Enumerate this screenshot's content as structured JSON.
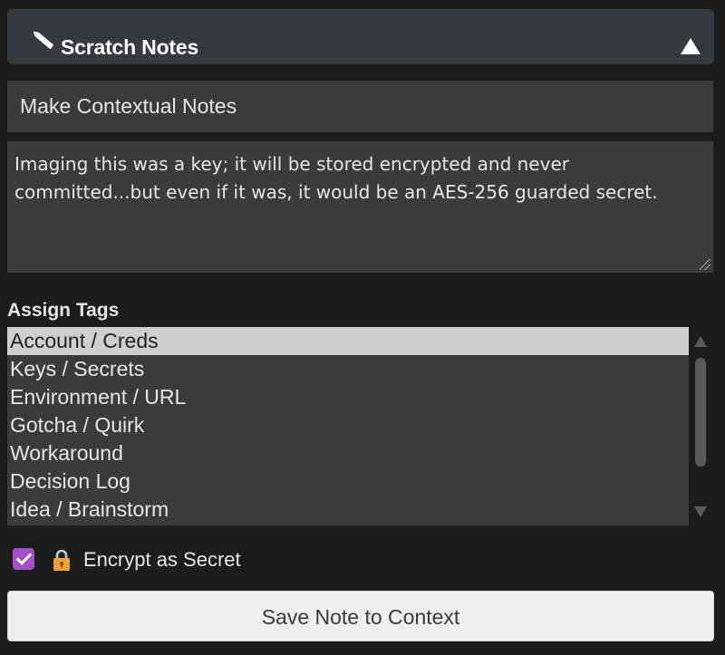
{
  "header": {
    "title": "Scratch Notes",
    "icon": "pencil-icon",
    "collapse_icon": "triangle-up-icon"
  },
  "note_title": {
    "value": "Make Contextual Notes"
  },
  "note_body": {
    "value": "Imaging this was a key; it will be stored encrypted and never committed...but even if it was, it would be an AES-256 guarded secret."
  },
  "tags": {
    "label": "Assign Tags",
    "items": [
      {
        "label": "Account / Creds",
        "selected": true
      },
      {
        "label": "Keys / Secrets",
        "selected": false
      },
      {
        "label": "Environment / URL",
        "selected": false
      },
      {
        "label": "Gotcha / Quirk",
        "selected": false
      },
      {
        "label": "Workaround",
        "selected": false
      },
      {
        "label": "Decision Log",
        "selected": false
      },
      {
        "label": "Idea / Brainstorm",
        "selected": false
      }
    ]
  },
  "encrypt": {
    "checked": true,
    "icon": "lock-icon",
    "label": "Encrypt as Secret"
  },
  "save_button": {
    "label": "Save Note to Context"
  },
  "colors": {
    "background": "#1c1c1c",
    "header_bg": "#343a40",
    "field_bg": "#3b3b3b",
    "selected_bg": "#cfcfcf",
    "checkbox_accent": "#a34fc9",
    "lock_body": "#f0a030",
    "button_bg": "#efefef"
  }
}
